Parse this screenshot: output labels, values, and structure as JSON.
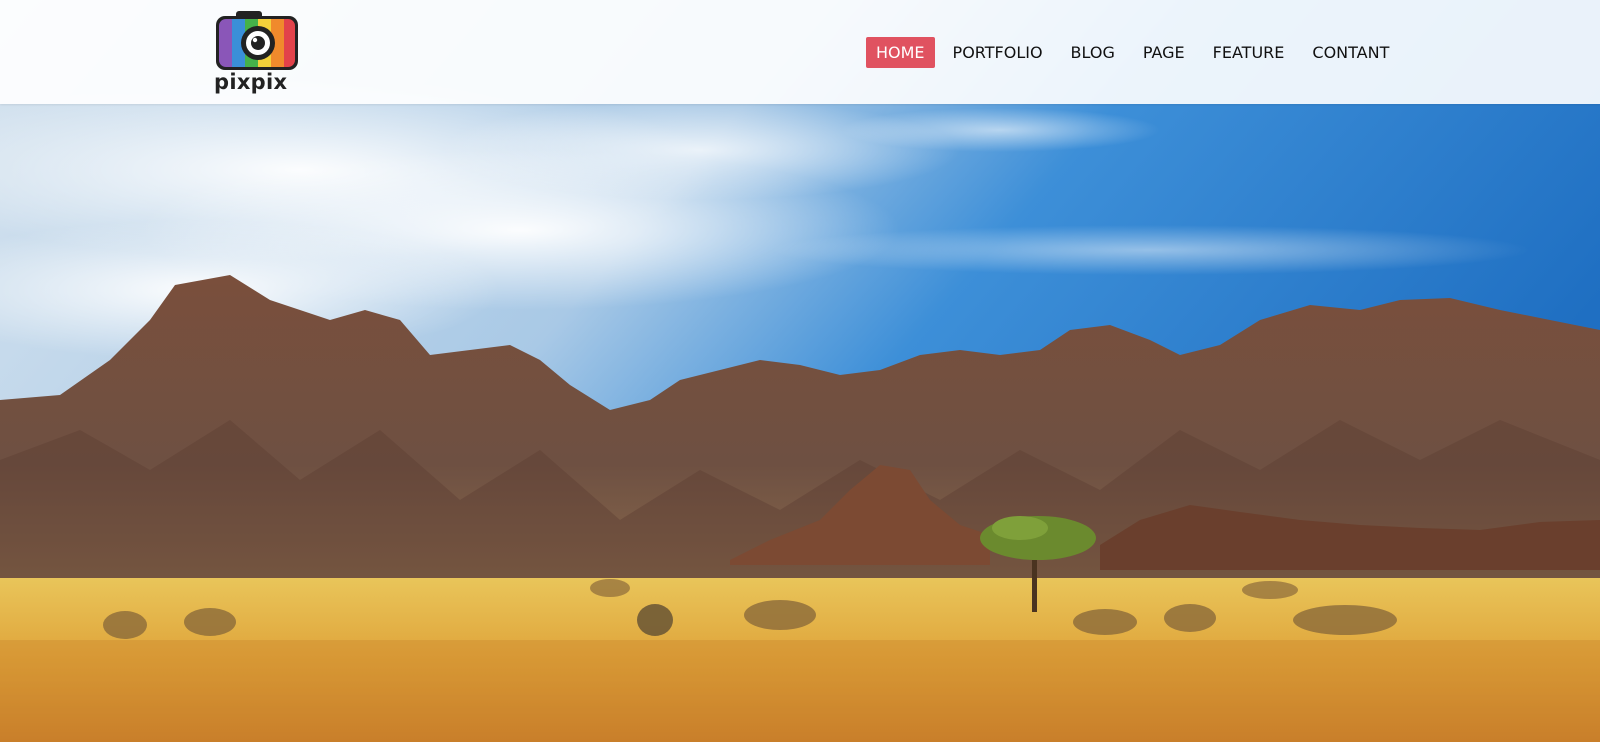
{
  "brand": {
    "name": "pixpix"
  },
  "nav": {
    "items": [
      {
        "label": "HOME",
        "active": true
      },
      {
        "label": "PORTFOLIO",
        "active": false
      },
      {
        "label": "BLOG",
        "active": false
      },
      {
        "label": "PAGE",
        "active": false
      },
      {
        "label": "FEATURE",
        "active": false
      },
      {
        "label": "CONTANT",
        "active": false
      }
    ]
  },
  "hero": {
    "image": "desert-mountains-landscape"
  },
  "colors": {
    "accent": "#e05260",
    "sky_top": "#2f7fcf",
    "mountain": "#6b4a3a",
    "ground": "#e0a83a"
  }
}
